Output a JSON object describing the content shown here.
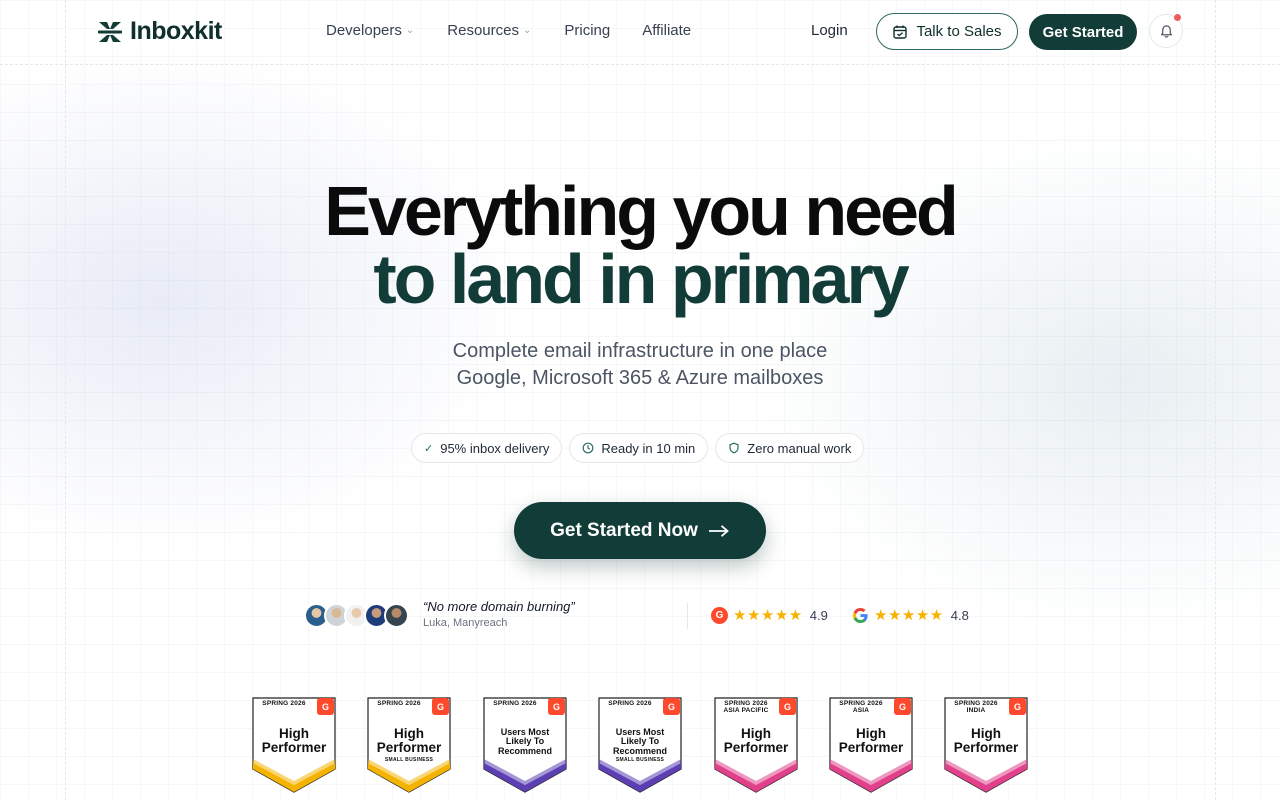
{
  "brand": {
    "name": "Inboxkit",
    "accent": "#123c37"
  },
  "nav": {
    "links": [
      {
        "label": "Developers",
        "has_dropdown": true
      },
      {
        "label": "Resources",
        "has_dropdown": true
      },
      {
        "label": "Pricing",
        "has_dropdown": false
      },
      {
        "label": "Affiliate",
        "has_dropdown": false
      }
    ],
    "login": "Login",
    "talk_to_sales": "Talk to Sales",
    "get_started": "Get Started",
    "icons": {
      "talk": "calendar-icon",
      "notifications": "bell-icon",
      "dropdown": "chevron-down-icon"
    }
  },
  "hero": {
    "headline_line1": "Everything you need",
    "headline_line2": "to land in primary",
    "sub_line1": "Complete email infrastructure in one place",
    "sub_line2": "Google, Microsoft 365 & Azure mailboxes",
    "chips": [
      {
        "label": "95% inbox delivery",
        "icon": "check-icon"
      },
      {
        "label": "Ready in 10 min",
        "icon": "clock-icon"
      },
      {
        "label": "Zero manual work",
        "icon": "shield-icon"
      }
    ],
    "cta": "Get Started Now",
    "cta_icon": "arrow-right-icon"
  },
  "social_proof": {
    "quote": "“No more domain burning”",
    "author": "Luka, Manyreach",
    "avatar_count": 5,
    "ratings": [
      {
        "source": "G2",
        "stars": 5,
        "score": "4.9"
      },
      {
        "source": "Google",
        "stars": 5,
        "score": "4.8"
      }
    ]
  },
  "badges": [
    {
      "season": "SPRING 2026",
      "title": "High Performer",
      "subtitle": "",
      "color": "#f5b301"
    },
    {
      "season": "SPRING 2026",
      "title": "High Performer",
      "subtitle": "SMALL BUSINESS",
      "color": "#f5b301"
    },
    {
      "season": "SPRING 2026",
      "title": "Users Most Likely To Recommend",
      "subtitle": "",
      "color": "#5b3fb3"
    },
    {
      "season": "SPRING 2026",
      "title": "Users Most Likely To Recommend",
      "subtitle": "SMALL BUSINESS",
      "color": "#5b3fb3"
    },
    {
      "season": "SPRING 2026 ASIA PACIFIC",
      "title": "High Performer",
      "subtitle": "",
      "color": "#e0418a"
    },
    {
      "season": "SPRING 2026 ASIA",
      "title": "High Performer",
      "subtitle": "",
      "color": "#e0418a"
    },
    {
      "season": "SPRING 2026 INDIA",
      "title": "High Performer",
      "subtitle": "",
      "color": "#e0418a"
    }
  ]
}
